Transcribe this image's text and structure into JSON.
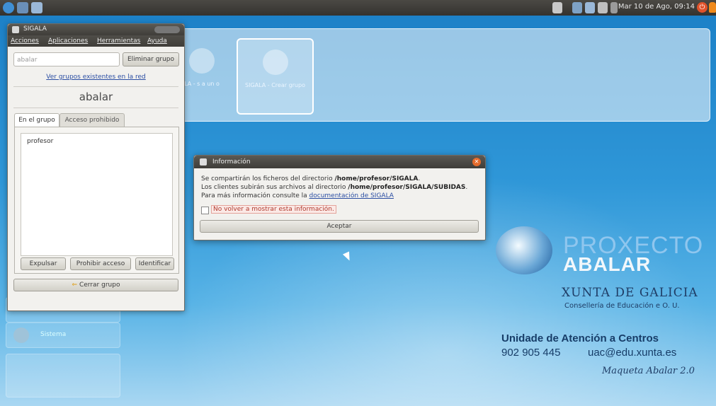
{
  "topbar": {
    "clock": "Mar 10 de Ago, 09:14"
  },
  "desktop": {
    "tiles": [
      {
        "label": "SIGALA - Crear grupo"
      },
      {
        "label": "LA - s a un o"
      }
    ],
    "side_item": {
      "label": "Sistema"
    }
  },
  "branding": {
    "proxecto": "PROXECTO",
    "abalar": "ABALAR",
    "xunta": "XUNTA DE GALICIA",
    "conselleria": "Consellería de Educación e O. U.",
    "unidade": "Unidade de Atención a Centros",
    "phone": "902 905 445",
    "email": "uac@edu.xunta.es",
    "maqueta": "Maqueta Abalar 2.0"
  },
  "sigala_window": {
    "title": "SIGALA",
    "menu": [
      "Acciones",
      "Aplicaciones",
      "Herramientas",
      "Ayuda"
    ],
    "search_value": "abalar",
    "remove_group_label": "Eliminar grupo",
    "view_groups_link": "Ver grupos existentes en la red",
    "group_name": "abalar",
    "tabs": [
      "En el grupo",
      "Acceso prohibido"
    ],
    "members": [
      "profesor"
    ],
    "actions": [
      "Expulsar",
      "Prohibir acceso",
      "Identificar"
    ],
    "close_group_label": "Cerrar grupo"
  },
  "info_dialog": {
    "title": "Información",
    "line1_prefix": "Se compartirán los ficheros del directorio ",
    "line1_path": "/home/profesor/SIGALA",
    "line1_suffix": ".",
    "line2_prefix": "Los clientes subirán sus archivos al directorio ",
    "line2_path": "/home/profesor/SIGALA/SUBIDAS",
    "line2_suffix": ".",
    "line3_prefix": "Para más información consulte la ",
    "line3_link": "documentación de SIGALA",
    "checkbox_label": "No volver a mostrar esta información.",
    "accept_label": "Aceptar"
  }
}
